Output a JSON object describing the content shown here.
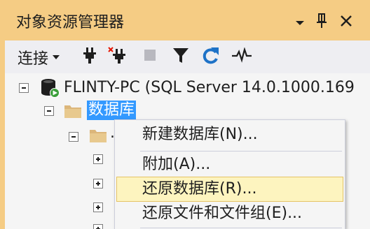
{
  "panel": {
    "title": "对象资源管理器",
    "accent_color": "#f5cc84",
    "window_buttons": [
      "dropdown-icon",
      "pin-icon",
      "close-icon"
    ]
  },
  "toolbar": {
    "connect_label": "连接",
    "icons": [
      "connect-plug-icon",
      "disconnect-plug-icon",
      "stop-icon",
      "filter-icon",
      "refresh-icon",
      "activity-monitor-icon"
    ]
  },
  "tree": {
    "server_label": "FLINTY-PC (SQL Server 14.0.1000.169",
    "databases_label": "数据库",
    "truncated_child_label": "."
  },
  "context_menu": {
    "items": [
      {
        "label": "新建数据库(N)...",
        "highlighted": false
      },
      {
        "label": "附加(A)...",
        "highlighted": false
      },
      {
        "label": "还原数据库(R)...",
        "highlighted": true
      },
      {
        "label": "还原文件和文件组(E)...",
        "highlighted": false
      }
    ],
    "highlight_color": "#fdf4bf"
  }
}
